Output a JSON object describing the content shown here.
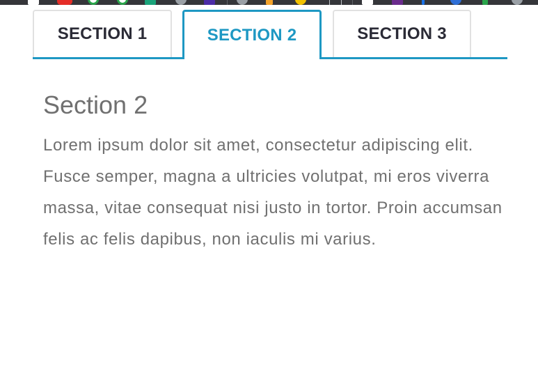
{
  "tabs": [
    {
      "label": "SECTION 1",
      "active": false
    },
    {
      "label": "SECTION 2",
      "active": true
    },
    {
      "label": "SECTION 3",
      "active": false
    }
  ],
  "panel": {
    "heading": "Section 2",
    "body": "Lorem ipsum dolor sit amet, consectetur adipiscing elit. Fusce semper, magna a ultricies volutpat, mi eros viverra massa, vitae consequat nisi justo in tortor. Proin accumsan felis ac felis dapibus, non iaculis mi varius."
  },
  "colors": {
    "accent": "#1e98c3",
    "tab_text": "#2b2b36",
    "tab_border": "#e1e1e1",
    "body_text": "#707070",
    "background": "#ffffff",
    "browser_bar": "#35363a"
  }
}
